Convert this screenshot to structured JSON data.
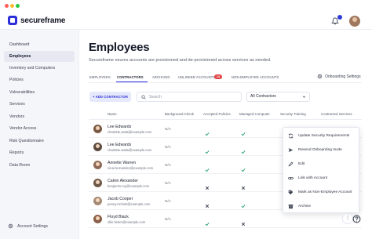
{
  "app": {
    "logo_text": "secureframe",
    "brand_color": "#2a2fd8",
    "window_dots": [
      "#ff5f57",
      "#febc2e",
      "#28c840"
    ]
  },
  "sidebar": {
    "items": [
      {
        "label": "Dashboard",
        "active": false
      },
      {
        "label": "Employees",
        "active": true
      },
      {
        "label": "Inventory and Computers",
        "active": false
      },
      {
        "label": "Policies",
        "active": false
      },
      {
        "label": "Vulnerabilities",
        "active": false
      },
      {
        "label": "Services",
        "active": false
      },
      {
        "label": "Vendors",
        "active": false
      },
      {
        "label": "Vendor Access",
        "active": false
      },
      {
        "label": "Risk Questionnaire",
        "active": false
      },
      {
        "label": "Reports",
        "active": false
      },
      {
        "label": "Data Room",
        "active": false
      }
    ],
    "settings_label": "Account Settings"
  },
  "main": {
    "title": "Employees",
    "subtitle": "Secureframe esures accounts are provisioned and de-provisioned across services as needed.",
    "tabs": [
      {
        "label": "EMPLOYEES",
        "active": false
      },
      {
        "label": "CONTRACTORS",
        "active": true
      },
      {
        "label": "ARCHIVED",
        "active": false
      },
      {
        "label": "UNLINKED ACCOUNTS",
        "active": false,
        "badge": "14"
      },
      {
        "label": "NON-EMPLOYEE ACCOUNTS",
        "active": false
      }
    ],
    "onboarding_settings_label": "Onboarding Settings",
    "add_button_label": "+ ADD CONTRACTOR",
    "search_placeholder": "Search",
    "filter_value": "All Contractors"
  },
  "table": {
    "columns": [
      "Name",
      "Background Check",
      "Accepted Policies",
      "Managed Computer",
      "Security Training",
      "Contracted Services"
    ],
    "rows": [
      {
        "name": "Lee Edwards",
        "email": "charlotte.watts@example.com",
        "background_check": "N/A",
        "accepted_policies": "check",
        "managed_computer": "check",
        "avatar_color": "#7a5a44"
      },
      {
        "name": "Lee Edwards",
        "email": "charlotte.watts@example.com",
        "background_check": "N/A",
        "accepted_policies": "check",
        "managed_computer": "check",
        "avatar_color": "#5b4a3e"
      },
      {
        "name": "Annette Warren",
        "email": "nina.hernandez@example.com",
        "background_check": "N/A",
        "accepted_policies": "check",
        "managed_computer": "check",
        "avatar_color": "#8d6a56"
      },
      {
        "name": "Calvin Alexander",
        "email": "benjamin.roy@example.com",
        "background_check": "N/A",
        "accepted_policies": "x",
        "managed_computer": "x",
        "avatar_color": "#6e5847"
      },
      {
        "name": "Jacob Cooper",
        "email": "penny.nichols@example.com",
        "background_check": "N/A",
        "accepted_policies": "x",
        "managed_computer": "check",
        "avatar_color": "#a48a76"
      },
      {
        "name": "Floyd Black",
        "email": "ollie.foster@example.com",
        "background_check": "N/A",
        "accepted_policies": "check",
        "managed_computer": "x",
        "avatar_color": "#8a5f48"
      }
    ]
  },
  "context_menu": {
    "items": [
      {
        "label": "Update Security Requirements",
        "icon": "sync-icon"
      },
      {
        "label": "Resend Onboarding Invite",
        "icon": "send-icon"
      },
      {
        "label": "Edit",
        "icon": "pencil-icon"
      },
      {
        "label": "Link with Account",
        "icon": "link-icon"
      },
      {
        "label": "Mark as Non-Employee Account",
        "icon": "tag-icon"
      },
      {
        "label": "Archive",
        "icon": "archive-icon"
      }
    ]
  },
  "colors": {
    "success": "#22a06b",
    "danger": "#3c4252",
    "badge": "#e24545"
  }
}
